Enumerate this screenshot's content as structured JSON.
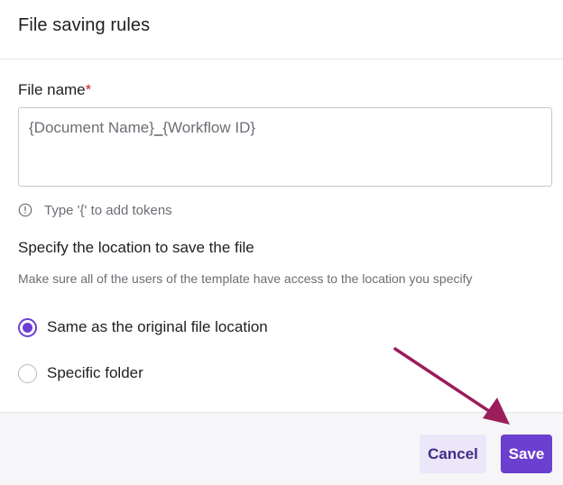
{
  "dialog": {
    "title": "File saving rules"
  },
  "file_name": {
    "label": "File name",
    "required_mark": "*",
    "value_part1": "{Document Name}",
    "value_sep": "_",
    "value_part2": "{Workflow ID}",
    "hint": "Type '{' to add tokens",
    "hint_icon": "info-circle-icon"
  },
  "location": {
    "title": "Specify the location to save the file",
    "description": "Make sure all of the users of the template have access to the location you specify",
    "options": [
      {
        "label": "Same as the original file location",
        "selected": true
      },
      {
        "label": "Specific folder",
        "selected": false
      }
    ]
  },
  "footer": {
    "cancel_label": "Cancel",
    "save_label": "Save"
  },
  "colors": {
    "accent": "#6b3fd0",
    "annotation_arrow": "#9b1d5a",
    "required": "#d21f3c"
  }
}
